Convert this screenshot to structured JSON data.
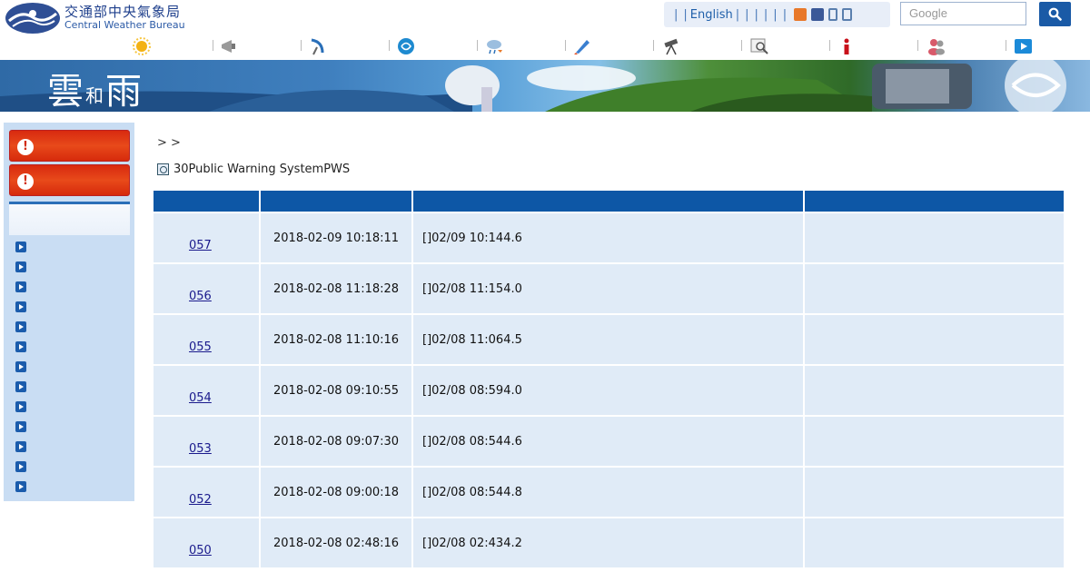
{
  "header": {
    "logo_cn": "交通部中央氣象局",
    "logo_en": "Central Weather Bureau",
    "toplinks": {
      "separators": [
        "|",
        "|",
        "|",
        "|",
        "|",
        "|",
        "|",
        "|"
      ],
      "english": "English"
    },
    "search_placeholder": "Google",
    "nav_icons": [
      "sun-icon",
      "megaphone-icon",
      "satellite-dish-icon",
      "typhoon-icon",
      "rain-cloud-icon",
      "rocket-icon",
      "telescope-icon",
      "chart-magnifier-icon",
      "info-icon",
      "people-icon",
      "play-icon"
    ]
  },
  "banner": {
    "title_a": "雲",
    "title_b": "和",
    "title_c": "雨"
  },
  "main": {
    "breadcrumb": ">  >",
    "page_title": "30Public Warning SystemPWS",
    "rows": [
      {
        "id": "057",
        "time": "2018-02-09 10:18:11",
        "desc": "[]02/09 10:144.6"
      },
      {
        "id": "056",
        "time": "2018-02-08 11:18:28",
        "desc": "[]02/08 11:154.0"
      },
      {
        "id": "055",
        "time": "2018-02-08 11:10:16",
        "desc": "[]02/08 11:064.5"
      },
      {
        "id": "054",
        "time": "2018-02-08 09:10:55",
        "desc": "[]02/08 08:594.0"
      },
      {
        "id": "053",
        "time": "2018-02-08 09:07:30",
        "desc": "[]02/08 08:544.6"
      },
      {
        "id": "052",
        "time": "2018-02-08 09:00:18",
        "desc": "[]02/08 08:544.8"
      },
      {
        "id": "050",
        "time": "2018-02-08 02:48:16",
        "desc": "[]02/08 02:434.2"
      }
    ]
  },
  "colors": {
    "header_blue": "#0d57a6",
    "row_bg": "#e0ebf7",
    "alert_red": "#e03a14",
    "sidebar_bg": "#c9ddf3"
  }
}
